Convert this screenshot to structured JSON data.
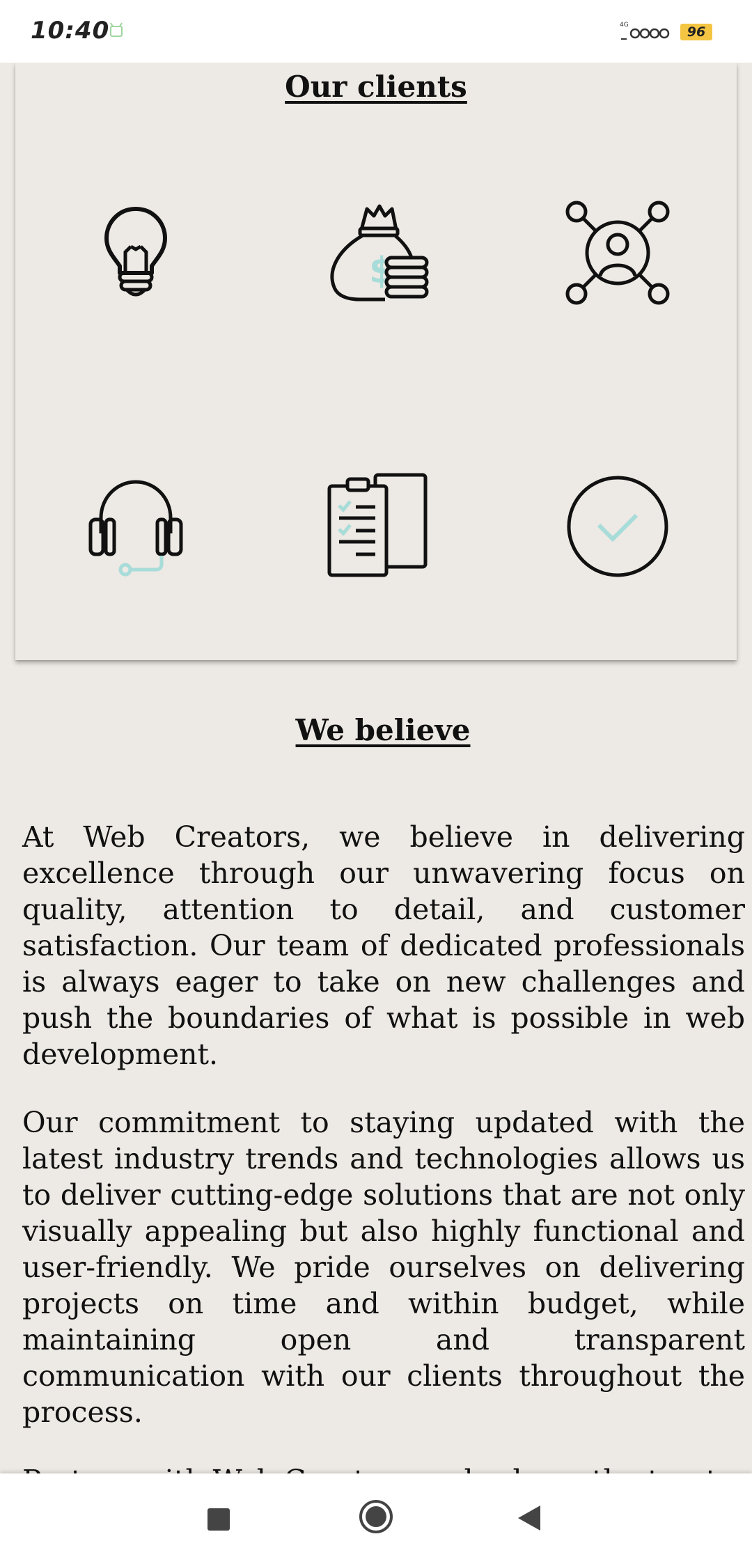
{
  "status_bar": {
    "time": "10:40",
    "battery_level": "96",
    "icons": [
      "notification-icon",
      "signal-icon",
      "wifi-icon",
      "battery-icon"
    ]
  },
  "clients": {
    "title": "Our clients",
    "icons": [
      "lightbulb-icon",
      "money-bag-icon",
      "network-user-icon",
      "headset-icon",
      "clipboard-icon",
      "check-circle-icon"
    ],
    "accent_color": "#a8dcd9"
  },
  "believe": {
    "title": "We believe",
    "paragraphs": [
      "At Web Creators, we believe in delivering excellence through our unwavering focus on quality, attention to detail, and customer satisfaction. Our team of dedicated professionals is always eager to take on new challenges and push the boundaries of what is possible in web development.",
      "Our commitment to staying updated with the latest industry trends and technologies allows us to deliver cutting-edge solutions that are not only visually appealing but also highly functional and user-friendly. We pride ourselves on delivering projects on time and within budget, while maintaining open and transparent communication with our clients throughout the process.",
      "Partner with Web Creators and rely on the trust"
    ]
  },
  "nav_bar": {
    "buttons": [
      "recents-button",
      "home-button",
      "back-button"
    ]
  }
}
